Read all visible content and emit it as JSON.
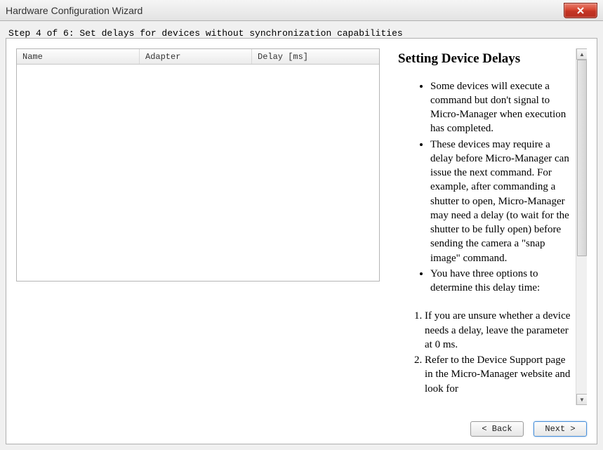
{
  "window": {
    "title": "Hardware Configuration Wizard"
  },
  "step_label": "Step 4 of 6: Set delays for devices without synchronization capabilities",
  "table": {
    "columns": {
      "name": "Name",
      "adapter": "Adapter",
      "delay": "Delay [ms]"
    },
    "rows": []
  },
  "help": {
    "title": "Setting Device Delays",
    "bullets": [
      "Some devices will execute a command but don't signal to Micro-Manager when execution has completed.",
      "These devices may require a delay before Micro-Manager can issue the next command. For example, after commanding a shutter to open, Micro-Manager may need a delay (to wait for the shutter to be fully open) before sending the camera a \"snap image\" command.",
      "You have three options to determine this delay time:"
    ],
    "numbered": [
      "If you are unsure whether a device needs a delay, leave the parameter at 0 ms.",
      "Refer to the Device Support page in the Micro-Manager website and look for"
    ]
  },
  "buttons": {
    "back": "< Back",
    "next": "Next >"
  }
}
